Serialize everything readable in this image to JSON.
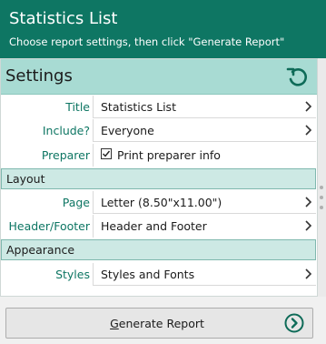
{
  "header": {
    "title": "Statistics List",
    "subtitle": "Choose report settings, then click \"Generate Report\""
  },
  "settings": {
    "label": "Settings",
    "reset_icon": "undo-icon"
  },
  "rows": {
    "title": {
      "label": "Title",
      "value": "Statistics List"
    },
    "include": {
      "label": "Include?",
      "value": "Everyone"
    },
    "preparer": {
      "label": "Preparer",
      "checkbox_label": "Print preparer info",
      "checked": true
    },
    "page": {
      "label": "Page",
      "value": "Letter (8.50\"x11.00\")"
    },
    "header_footer": {
      "label": "Header/Footer",
      "value": "Header and Footer"
    },
    "styles": {
      "label": "Styles",
      "value": "Styles and Fonts"
    }
  },
  "sections": {
    "layout": "Layout",
    "appearance": "Appearance"
  },
  "generate": {
    "first_letter": "G",
    "rest": "enerate Report",
    "icon": "arrow-right-circle-icon"
  },
  "colors": {
    "header_bg": "#0e7663",
    "settings_bar": "#a8dbd3",
    "section_bg": "#cde9e4",
    "label_text": "#0e7663"
  }
}
